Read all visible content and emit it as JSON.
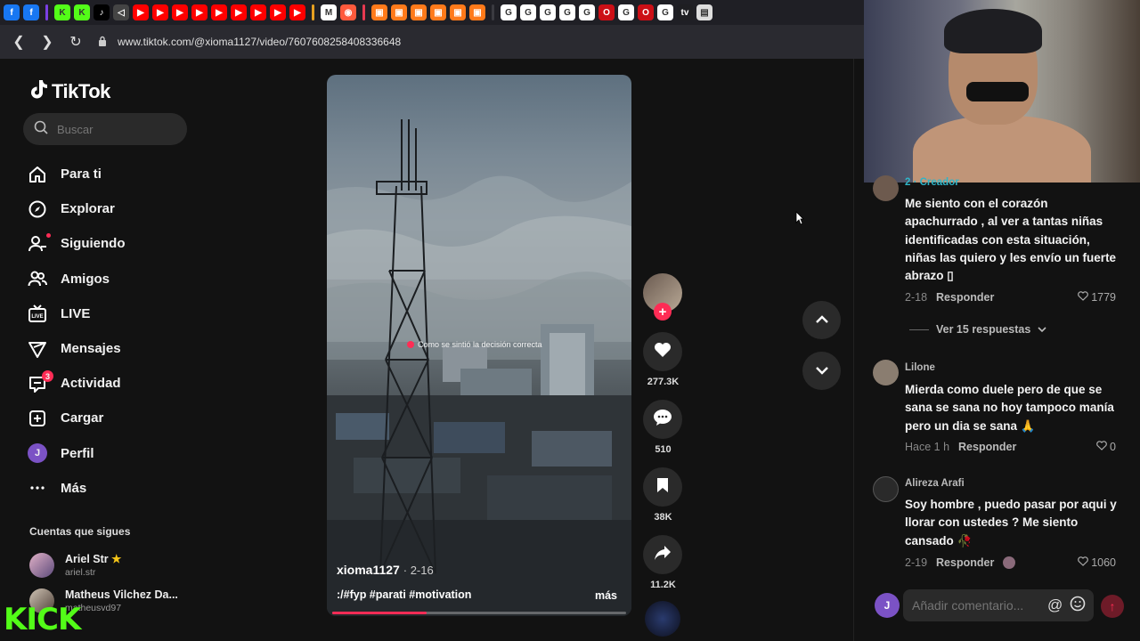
{
  "browser": {
    "url": "www.tiktok.com/@xioma1127/video/7607608258408336648",
    "tabs": [
      {
        "icon": "facebook-icon",
        "glyph": "f",
        "bg": "#1877f2"
      },
      {
        "icon": "facebook-icon",
        "glyph": "f",
        "bg": "#1877f2"
      },
      {
        "sep": "#7b3fe4"
      },
      {
        "icon": "kick-icon",
        "glyph": "K",
        "bg": "#53fc18"
      },
      {
        "icon": "kick-icon",
        "glyph": "K",
        "bg": "#53fc18"
      },
      {
        "icon": "tiktok-icon",
        "glyph": "♪",
        "bg": "#000000"
      },
      {
        "icon": "speaker-icon",
        "glyph": "◁",
        "bg": "#444444"
      },
      {
        "icon": "youtube-icon",
        "glyph": "▶",
        "bg": "#ff0000"
      },
      {
        "icon": "youtube-icon",
        "glyph": "▶",
        "bg": "#ff0000"
      },
      {
        "icon": "youtube-icon",
        "glyph": "▶",
        "bg": "#ff0000"
      },
      {
        "icon": "youtube-icon",
        "glyph": "▶",
        "bg": "#ff0000"
      },
      {
        "icon": "youtube-icon",
        "glyph": "▶",
        "bg": "#ff0000"
      },
      {
        "icon": "youtube-icon",
        "glyph": "▶",
        "bg": "#ff0000"
      },
      {
        "icon": "youtube-icon",
        "glyph": "▶",
        "bg": "#ff0000"
      },
      {
        "icon": "youtube-icon",
        "glyph": "▶",
        "bg": "#ff0000"
      },
      {
        "icon": "youtube-icon",
        "glyph": "▶",
        "bg": "#ff0000"
      },
      {
        "sep": "#e6a020"
      },
      {
        "icon": "gmail-icon",
        "glyph": "M",
        "bg": "#ffffff"
      },
      {
        "icon": "app-icon",
        "glyph": "◉",
        "bg": "#ff5a3c"
      },
      {
        "sep": "#e63950"
      },
      {
        "icon": "shop-icon",
        "glyph": "▣",
        "bg": "#ff7a1a"
      },
      {
        "icon": "shop-icon",
        "glyph": "▣",
        "bg": "#ff7a1a"
      },
      {
        "icon": "shop-icon",
        "glyph": "▣",
        "bg": "#ff7a1a"
      },
      {
        "icon": "shop-icon",
        "glyph": "▣",
        "bg": "#ff7a1a"
      },
      {
        "icon": "shop-icon",
        "glyph": "▣",
        "bg": "#ff7a1a"
      },
      {
        "icon": "shop-icon",
        "glyph": "▣",
        "bg": "#ff7a1a"
      },
      {
        "sep": "#3a3a40"
      },
      {
        "icon": "google-icon",
        "glyph": "G",
        "bg": "#ffffff"
      },
      {
        "icon": "google-icon",
        "glyph": "G",
        "bg": "#ffffff"
      },
      {
        "icon": "google-icon",
        "glyph": "G",
        "bg": "#ffffff"
      },
      {
        "icon": "google-icon",
        "glyph": "G",
        "bg": "#ffffff"
      },
      {
        "icon": "google-icon",
        "glyph": "G",
        "bg": "#ffffff"
      },
      {
        "icon": "opera-icon",
        "glyph": "O",
        "bg": "#cc0f16"
      },
      {
        "icon": "google-icon",
        "glyph": "G",
        "bg": "#ffffff"
      },
      {
        "icon": "opera-icon",
        "glyph": "O",
        "bg": "#cc0f16"
      },
      {
        "icon": "google-icon",
        "glyph": "G",
        "bg": "#ffffff"
      },
      {
        "icon": "tradingview-icon",
        "glyph": "tv",
        "bg": "#1e1e22"
      },
      {
        "icon": "document-icon",
        "glyph": "▤",
        "bg": "#dddddd"
      }
    ]
  },
  "sidebar": {
    "logo": "TikTok",
    "search_placeholder": "Buscar",
    "items": [
      {
        "label": "Para ti",
        "name": "home",
        "icon": "home-icon"
      },
      {
        "label": "Explorar",
        "name": "explore",
        "icon": "compass-icon"
      },
      {
        "label": "Siguiendo",
        "name": "following",
        "icon": "user-add-icon"
      },
      {
        "label": "Amigos",
        "name": "friends",
        "icon": "friends-icon"
      },
      {
        "label": "LIVE",
        "name": "live",
        "icon": "live-icon"
      },
      {
        "label": "Mensajes",
        "name": "messages",
        "icon": "send-icon"
      },
      {
        "label": "Actividad",
        "name": "activity",
        "icon": "activity-icon",
        "badge": "3"
      },
      {
        "label": "Cargar",
        "name": "upload",
        "icon": "plus-square-icon"
      },
      {
        "label": "Perfil",
        "name": "profile",
        "icon": "profile-avatar-icon",
        "avatar": "J"
      },
      {
        "label": "Más",
        "name": "more",
        "icon": "more-icon"
      }
    ],
    "following_title": "Cuentas que sigues",
    "following": [
      {
        "name": "Ariel Str",
        "handle": "ariel.str",
        "star": "★"
      },
      {
        "name": "Matheus Vilchez Da...",
        "handle": "matheusvd97"
      }
    ]
  },
  "overlay": {
    "kick_logo": "KICK"
  },
  "video": {
    "caption": "Como se sintió la decisión correcta",
    "author": "xioma1127",
    "date": "2-16",
    "description": ":/#fyp #parati #motivation",
    "more": "más",
    "progress": 0.32
  },
  "actions": {
    "likes": "277.3K",
    "comments": "510",
    "saves": "38K",
    "shares": "11.2K"
  },
  "comments": {
    "items": [
      {
        "name": "2 · Creador",
        "text": "Me siento con el corazón apachurrado , al ver a tantas niñas identificadas con esta situación, niñas las quiero y les envío un fuerte abrazo ▯",
        "date": "2-18",
        "reply": "Responder",
        "likes": "1779"
      },
      {
        "name": "Lilone",
        "text": "Mierda como duele pero de que se sana se sana no hoy tampoco manía pero un dia se sana 🙏",
        "date": "Hace 1 h",
        "reply": "Responder",
        "likes": "0"
      },
      {
        "name": "Alireza Arafi",
        "text": "Soy hombre , puedo pasar por aqui y llorar con ustedes ? Me siento cansado 🥀",
        "date": "2-19",
        "reply": "Responder",
        "likes": "1060"
      }
    ],
    "view_replies": "Ver 15 respuestas",
    "input_placeholder": "Añadir comentario...",
    "user_avatar": "J"
  },
  "colors": {
    "accent": "#fe2c55",
    "background": "#121212",
    "kick": "#53fc18"
  }
}
